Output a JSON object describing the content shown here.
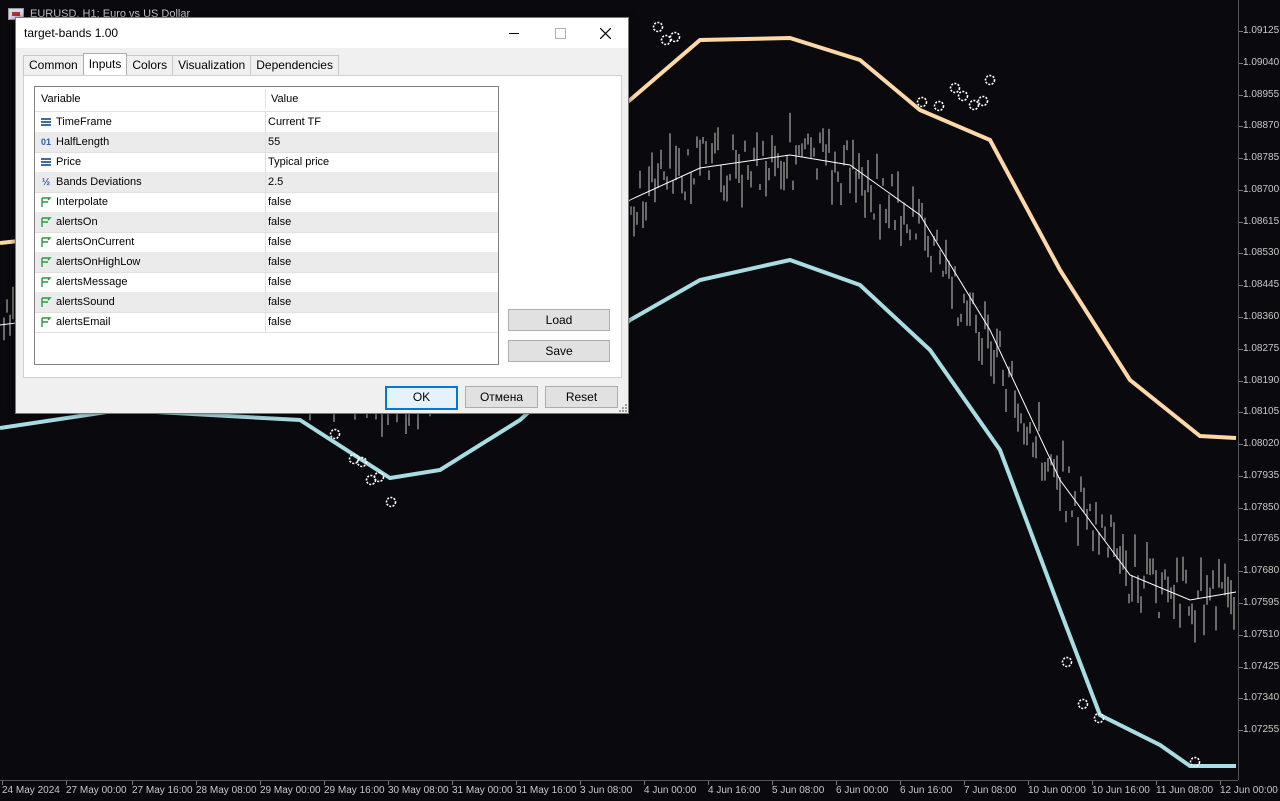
{
  "chart": {
    "title": "EURUSD, H1:  Euro vs US Dollar",
    "price_labels": [
      "1.09125",
      "1.09040",
      "1.08955",
      "1.08870",
      "1.08785",
      "1.08700",
      "1.08615",
      "1.08530",
      "1.08445",
      "1.08360",
      "1.08275",
      "1.08190",
      "1.08105",
      "1.08020",
      "1.07935",
      "1.07850",
      "1.07765",
      "1.07680",
      "1.07595",
      "1.07510",
      "1.07425",
      "1.07340",
      "1.07255"
    ],
    "time_labels": [
      "24 May 2024",
      "27 May 00:00",
      "27 May 16:00",
      "28 May 08:00",
      "29 May 00:00",
      "29 May 16:00",
      "30 May 08:00",
      "31 May 00:00",
      "31 May 16:00",
      "3 Jun 08:00",
      "4 Jun 00:00",
      "4 Jun 16:00",
      "5 Jun 08:00",
      "6 Jun 00:00",
      "6 Jun 16:00",
      "7 Jun 08:00",
      "10 Jun 00:00",
      "10 Jun 16:00",
      "11 Jun 08:00",
      "12 Jun 00:00"
    ],
    "colors": {
      "upper_band": "#ffd8a8",
      "lower_band": "#a8dde4",
      "middle_line": "#ffffff",
      "candles": "#8a8a8a",
      "background": "#0a0a0e"
    }
  },
  "dialog": {
    "title": "target-bands 1.00",
    "window_controls": {
      "minimize": "minimize-icon",
      "maximize": "maximize-icon",
      "close": "close-icon"
    },
    "tabs": [
      "Common",
      "Inputs",
      "Colors",
      "Visualization",
      "Dependencies"
    ],
    "active_tab": "Inputs",
    "grid": {
      "headers": {
        "variable": "Variable",
        "value": "Value"
      },
      "rows": [
        {
          "icon": "enum-icon",
          "name": "TimeFrame",
          "value": "Current TF"
        },
        {
          "icon": "integer-icon",
          "name": "HalfLength",
          "value": "55"
        },
        {
          "icon": "enum-icon",
          "name": "Price",
          "value": "Typical price"
        },
        {
          "icon": "double-icon",
          "name": "Bands Deviations",
          "value": "2.5"
        },
        {
          "icon": "bool-icon",
          "name": "Interpolate",
          "value": "false"
        },
        {
          "icon": "bool-icon",
          "name": "alertsOn",
          "value": "false"
        },
        {
          "icon": "bool-icon",
          "name": "alertsOnCurrent",
          "value": "false"
        },
        {
          "icon": "bool-icon",
          "name": "alertsOnHighLow",
          "value": "false"
        },
        {
          "icon": "bool-icon",
          "name": "alertsMessage",
          "value": "false"
        },
        {
          "icon": "bool-icon",
          "name": "alertsSound",
          "value": "false"
        },
        {
          "icon": "bool-icon",
          "name": "alertsEmail",
          "value": "false"
        }
      ]
    },
    "buttons": {
      "load": "Load",
      "save": "Save",
      "ok": "OK",
      "cancel": "Отмена",
      "reset": "Reset"
    }
  }
}
